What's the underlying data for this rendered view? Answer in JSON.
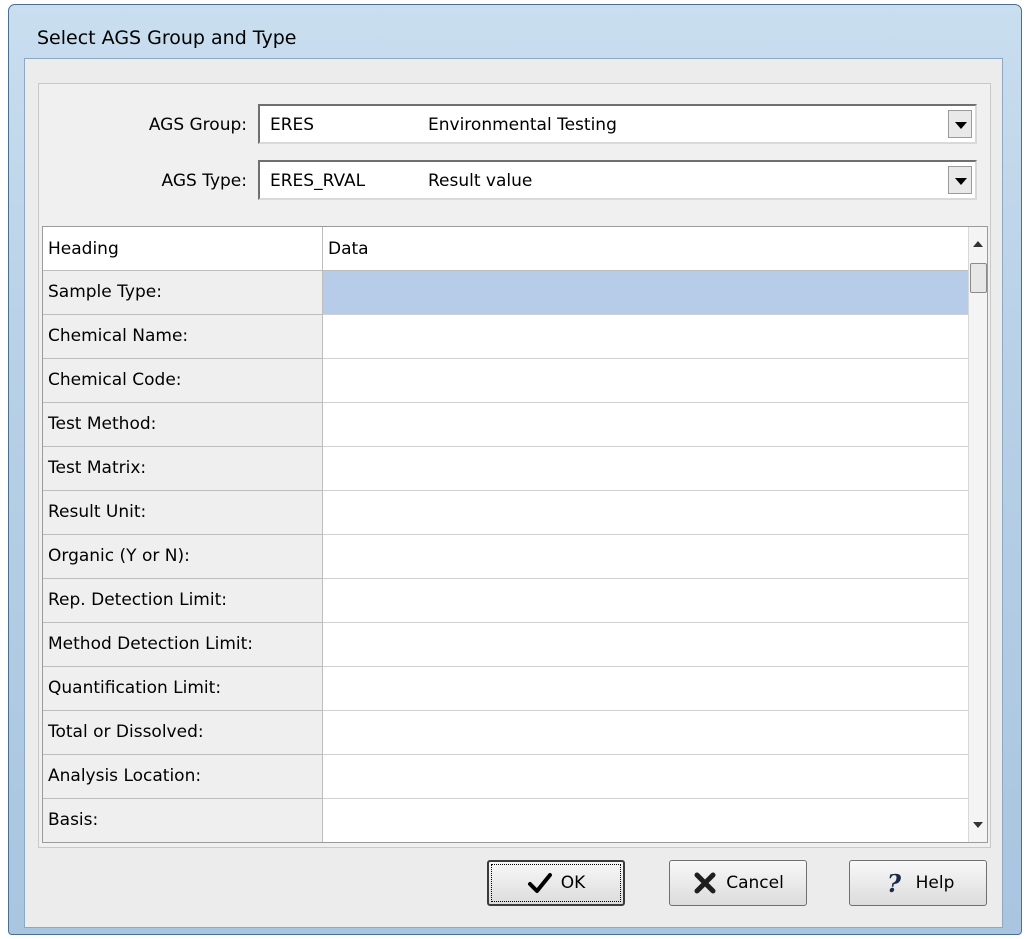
{
  "window": {
    "title": "Select AGS Group and Type"
  },
  "group": {
    "label": "AGS Group:",
    "code": "ERES",
    "description": "Environmental Testing"
  },
  "type": {
    "label": "AGS Type:",
    "code": "ERES_RVAL",
    "description": "Result value"
  },
  "grid": {
    "columns": [
      "Heading",
      "Data"
    ],
    "rows": [
      "Sample Type:",
      "Chemical Name:",
      "Chemical Code:",
      "Test Method:",
      "Test Matrix:",
      "Result Unit:",
      "Organic (Y or N):",
      "Rep. Detection Limit:",
      "Method Detection Limit:",
      "Quantification Limit:",
      "Total or Dissolved:",
      "Analysis Location:",
      "Basis:"
    ]
  },
  "buttons": {
    "ok": "OK",
    "cancel": "Cancel",
    "help": "Help"
  },
  "colors": {
    "selection": "#b6cce8",
    "frame": "#b7d0e6"
  },
  "icons": {
    "ok": "checkmark-icon",
    "cancel": "x-icon",
    "help": "question-icon"
  }
}
